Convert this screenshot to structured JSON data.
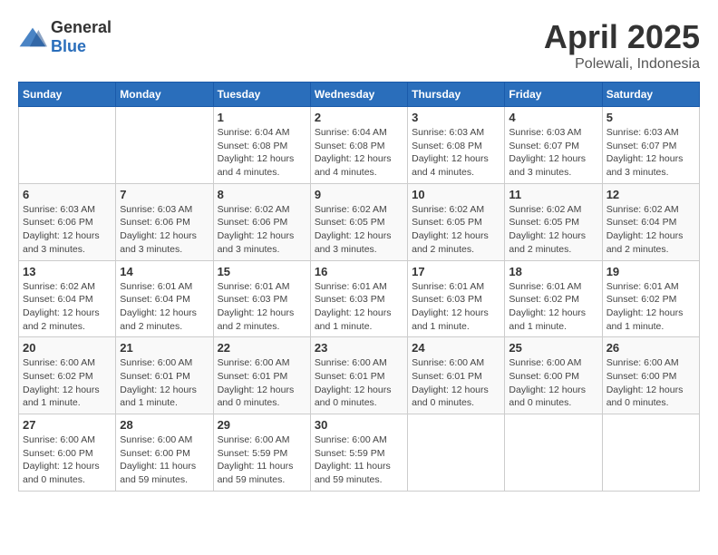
{
  "logo": {
    "text_general": "General",
    "text_blue": "Blue"
  },
  "title": "April 2025",
  "subtitle": "Polewali, Indonesia",
  "headers": [
    "Sunday",
    "Monday",
    "Tuesday",
    "Wednesday",
    "Thursday",
    "Friday",
    "Saturday"
  ],
  "weeks": [
    [
      {
        "num": "",
        "detail": ""
      },
      {
        "num": "",
        "detail": ""
      },
      {
        "num": "1",
        "detail": "Sunrise: 6:04 AM\nSunset: 6:08 PM\nDaylight: 12 hours\nand 4 minutes."
      },
      {
        "num": "2",
        "detail": "Sunrise: 6:04 AM\nSunset: 6:08 PM\nDaylight: 12 hours\nand 4 minutes."
      },
      {
        "num": "3",
        "detail": "Sunrise: 6:03 AM\nSunset: 6:08 PM\nDaylight: 12 hours\nand 4 minutes."
      },
      {
        "num": "4",
        "detail": "Sunrise: 6:03 AM\nSunset: 6:07 PM\nDaylight: 12 hours\nand 3 minutes."
      },
      {
        "num": "5",
        "detail": "Sunrise: 6:03 AM\nSunset: 6:07 PM\nDaylight: 12 hours\nand 3 minutes."
      }
    ],
    [
      {
        "num": "6",
        "detail": "Sunrise: 6:03 AM\nSunset: 6:06 PM\nDaylight: 12 hours\nand 3 minutes."
      },
      {
        "num": "7",
        "detail": "Sunrise: 6:03 AM\nSunset: 6:06 PM\nDaylight: 12 hours\nand 3 minutes."
      },
      {
        "num": "8",
        "detail": "Sunrise: 6:02 AM\nSunset: 6:06 PM\nDaylight: 12 hours\nand 3 minutes."
      },
      {
        "num": "9",
        "detail": "Sunrise: 6:02 AM\nSunset: 6:05 PM\nDaylight: 12 hours\nand 3 minutes."
      },
      {
        "num": "10",
        "detail": "Sunrise: 6:02 AM\nSunset: 6:05 PM\nDaylight: 12 hours\nand 2 minutes."
      },
      {
        "num": "11",
        "detail": "Sunrise: 6:02 AM\nSunset: 6:05 PM\nDaylight: 12 hours\nand 2 minutes."
      },
      {
        "num": "12",
        "detail": "Sunrise: 6:02 AM\nSunset: 6:04 PM\nDaylight: 12 hours\nand 2 minutes."
      }
    ],
    [
      {
        "num": "13",
        "detail": "Sunrise: 6:02 AM\nSunset: 6:04 PM\nDaylight: 12 hours\nand 2 minutes."
      },
      {
        "num": "14",
        "detail": "Sunrise: 6:01 AM\nSunset: 6:04 PM\nDaylight: 12 hours\nand 2 minutes."
      },
      {
        "num": "15",
        "detail": "Sunrise: 6:01 AM\nSunset: 6:03 PM\nDaylight: 12 hours\nand 2 minutes."
      },
      {
        "num": "16",
        "detail": "Sunrise: 6:01 AM\nSunset: 6:03 PM\nDaylight: 12 hours\nand 1 minute."
      },
      {
        "num": "17",
        "detail": "Sunrise: 6:01 AM\nSunset: 6:03 PM\nDaylight: 12 hours\nand 1 minute."
      },
      {
        "num": "18",
        "detail": "Sunrise: 6:01 AM\nSunset: 6:02 PM\nDaylight: 12 hours\nand 1 minute."
      },
      {
        "num": "19",
        "detail": "Sunrise: 6:01 AM\nSunset: 6:02 PM\nDaylight: 12 hours\nand 1 minute."
      }
    ],
    [
      {
        "num": "20",
        "detail": "Sunrise: 6:00 AM\nSunset: 6:02 PM\nDaylight: 12 hours\nand 1 minute."
      },
      {
        "num": "21",
        "detail": "Sunrise: 6:00 AM\nSunset: 6:01 PM\nDaylight: 12 hours\nand 1 minute."
      },
      {
        "num": "22",
        "detail": "Sunrise: 6:00 AM\nSunset: 6:01 PM\nDaylight: 12 hours\nand 0 minutes."
      },
      {
        "num": "23",
        "detail": "Sunrise: 6:00 AM\nSunset: 6:01 PM\nDaylight: 12 hours\nand 0 minutes."
      },
      {
        "num": "24",
        "detail": "Sunrise: 6:00 AM\nSunset: 6:01 PM\nDaylight: 12 hours\nand 0 minutes."
      },
      {
        "num": "25",
        "detail": "Sunrise: 6:00 AM\nSunset: 6:00 PM\nDaylight: 12 hours\nand 0 minutes."
      },
      {
        "num": "26",
        "detail": "Sunrise: 6:00 AM\nSunset: 6:00 PM\nDaylight: 12 hours\nand 0 minutes."
      }
    ],
    [
      {
        "num": "27",
        "detail": "Sunrise: 6:00 AM\nSunset: 6:00 PM\nDaylight: 12 hours\nand 0 minutes."
      },
      {
        "num": "28",
        "detail": "Sunrise: 6:00 AM\nSunset: 6:00 PM\nDaylight: 11 hours\nand 59 minutes."
      },
      {
        "num": "29",
        "detail": "Sunrise: 6:00 AM\nSunset: 5:59 PM\nDaylight: 11 hours\nand 59 minutes."
      },
      {
        "num": "30",
        "detail": "Sunrise: 6:00 AM\nSunset: 5:59 PM\nDaylight: 11 hours\nand 59 minutes."
      },
      {
        "num": "",
        "detail": ""
      },
      {
        "num": "",
        "detail": ""
      },
      {
        "num": "",
        "detail": ""
      }
    ]
  ]
}
